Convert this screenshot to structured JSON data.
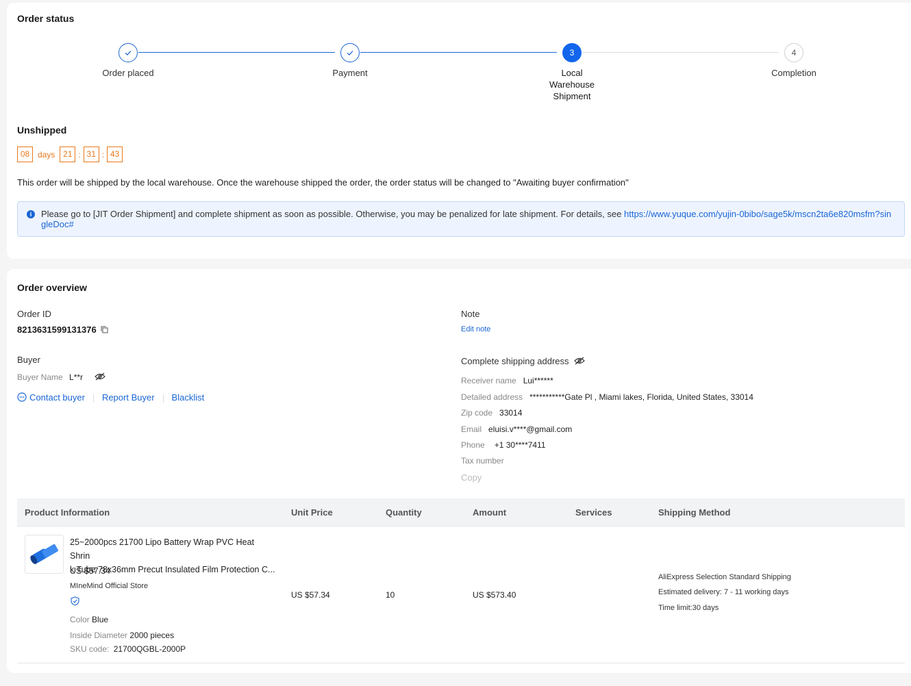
{
  "order_status": {
    "title": "Order status",
    "steps": [
      {
        "num": "",
        "label": "Order placed"
      },
      {
        "num": "",
        "label": "Payment"
      },
      {
        "num": "3",
        "label": "Local Warehouse Shipment"
      },
      {
        "num": "4",
        "label": "Completion"
      }
    ],
    "state_title": "Unshipped",
    "countdown": {
      "days": "08",
      "days_label": "days",
      "hours": "21",
      "minutes": "31",
      "seconds": "43",
      "colon": ":"
    },
    "description": "This order will be shipped by the local warehouse. Once the warehouse shipped the order, the order status will be changed to \"Awaiting buyer confirmation\"",
    "notice_text": "Please go to [JIT Order Shipment] and complete shipment as soon as possible. Otherwise, you may be penalized for late shipment. For details, see ",
    "notice_link": "https://www.yuque.com/yujin-0bibo/sage5k/mscn2ta6e820msfm?singleDoc#"
  },
  "overview": {
    "title": "Order overview",
    "order_id_label": "Order ID",
    "order_id": "8213631599131376",
    "note_label": "Note",
    "edit_note": "Edit note",
    "buyer_label": "Buyer",
    "buyer_name_label": "Buyer Name",
    "buyer_name": "L**r",
    "contact_buyer": "Contact buyer",
    "report_buyer": "Report Buyer",
    "blacklist": "Blacklist",
    "shipping_title": "Complete shipping address",
    "receiver_label": "Receiver name",
    "receiver": "Lui******",
    "address_label": "Detailed address",
    "address": "***********Gate Pl , Miami lakes, Florida, United States, 33014",
    "zip_label": "Zip code",
    "zip": "33014",
    "email_label": "Email",
    "email": "eluisi.v****@gmail.com",
    "phone_label": "Phone",
    "phone": "+1 30****7411",
    "tax_label": "Tax number",
    "copy": "Copy"
  },
  "table": {
    "headers": [
      "Product Information",
      "Unit Price",
      "Quantity",
      "Amount",
      "Services",
      "Shipping Method"
    ],
    "row": {
      "title_line1": "25~2000pcs 21700 Lipo Battery Wrap PVC Heat Shrin",
      "title_line2": "k Tube 78x36mm Precut Insulated Film Protection C...",
      "price": "US $57.34",
      "store": "MIneMind Official Store",
      "color_label": "Color",
      "color": "Blue",
      "diameter_label": "Inside Diameter",
      "diameter": "2000 pieces",
      "sku_label": "SKU code:",
      "sku": "21700QGBL-2000P",
      "unit_price": "US $57.34",
      "quantity": "10",
      "amount": "US $573.40",
      "shipping_method": "AliExpress Selection Standard Shipping",
      "estimated": "Estimated delivery: 7 - 11 working days",
      "time_limit": "Time limit:30 days"
    }
  },
  "colors": {
    "accent": "#1a66d4",
    "countdown": "#e8791c"
  }
}
